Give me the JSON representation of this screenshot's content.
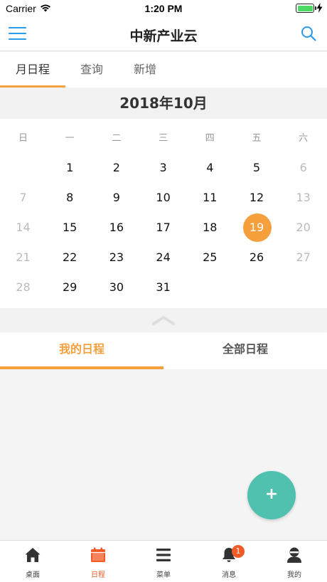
{
  "status_bar": {
    "carrier": "Carrier",
    "time": "1:20 PM"
  },
  "nav": {
    "title": "中新产业云",
    "accent_color": "#2b9be8"
  },
  "top_tabs": [
    {
      "label": "月日程",
      "active": true
    },
    {
      "label": "查询",
      "active": false
    },
    {
      "label": "新增",
      "active": false
    }
  ],
  "calendar": {
    "month_title": "2018年10月",
    "weekdays": [
      "日",
      "一",
      "二",
      "三",
      "四",
      "五",
      "六"
    ],
    "selected_day": "19",
    "selected_color": "#f5a03d",
    "weeks": [
      [
        {
          "d": "",
          "m": false
        },
        {
          "d": "1",
          "m": false
        },
        {
          "d": "2",
          "m": false
        },
        {
          "d": "3",
          "m": false
        },
        {
          "d": "4",
          "m": false
        },
        {
          "d": "5",
          "m": false
        },
        {
          "d": "6",
          "m": true
        }
      ],
      [
        {
          "d": "7",
          "m": true
        },
        {
          "d": "8",
          "m": false
        },
        {
          "d": "9",
          "m": false
        },
        {
          "d": "10",
          "m": false
        },
        {
          "d": "11",
          "m": false
        },
        {
          "d": "12",
          "m": false
        },
        {
          "d": "13",
          "m": true
        }
      ],
      [
        {
          "d": "14",
          "m": true
        },
        {
          "d": "15",
          "m": false
        },
        {
          "d": "16",
          "m": false
        },
        {
          "d": "17",
          "m": false
        },
        {
          "d": "18",
          "m": false
        },
        {
          "d": "19",
          "m": false
        },
        {
          "d": "20",
          "m": true
        }
      ],
      [
        {
          "d": "21",
          "m": true
        },
        {
          "d": "22",
          "m": false
        },
        {
          "d": "23",
          "m": false
        },
        {
          "d": "24",
          "m": false
        },
        {
          "d": "25",
          "m": false
        },
        {
          "d": "26",
          "m": false
        },
        {
          "d": "27",
          "m": true
        }
      ],
      [
        {
          "d": "28",
          "m": true
        },
        {
          "d": "29",
          "m": false
        },
        {
          "d": "30",
          "m": false
        },
        {
          "d": "31",
          "m": false
        },
        {
          "d": "",
          "m": false
        },
        {
          "d": "",
          "m": false
        },
        {
          "d": "",
          "m": false
        }
      ]
    ]
  },
  "schedule_tabs": [
    {
      "label": "我的日程",
      "active": true
    },
    {
      "label": "全部日程",
      "active": false
    }
  ],
  "fab": {
    "label": "+",
    "color": "#4fc1ae"
  },
  "tab_bar": {
    "items": [
      {
        "label": "桌面",
        "icon": "home-icon",
        "active": false
      },
      {
        "label": "日程",
        "icon": "calendar-icon",
        "active": true
      },
      {
        "label": "菜单",
        "icon": "menu-list-icon",
        "active": false
      },
      {
        "label": "消息",
        "icon": "bell-icon",
        "active": false,
        "badge": "1"
      },
      {
        "label": "我的",
        "icon": "profile-icon",
        "active": false
      }
    ],
    "active_color": "#f25a26"
  }
}
